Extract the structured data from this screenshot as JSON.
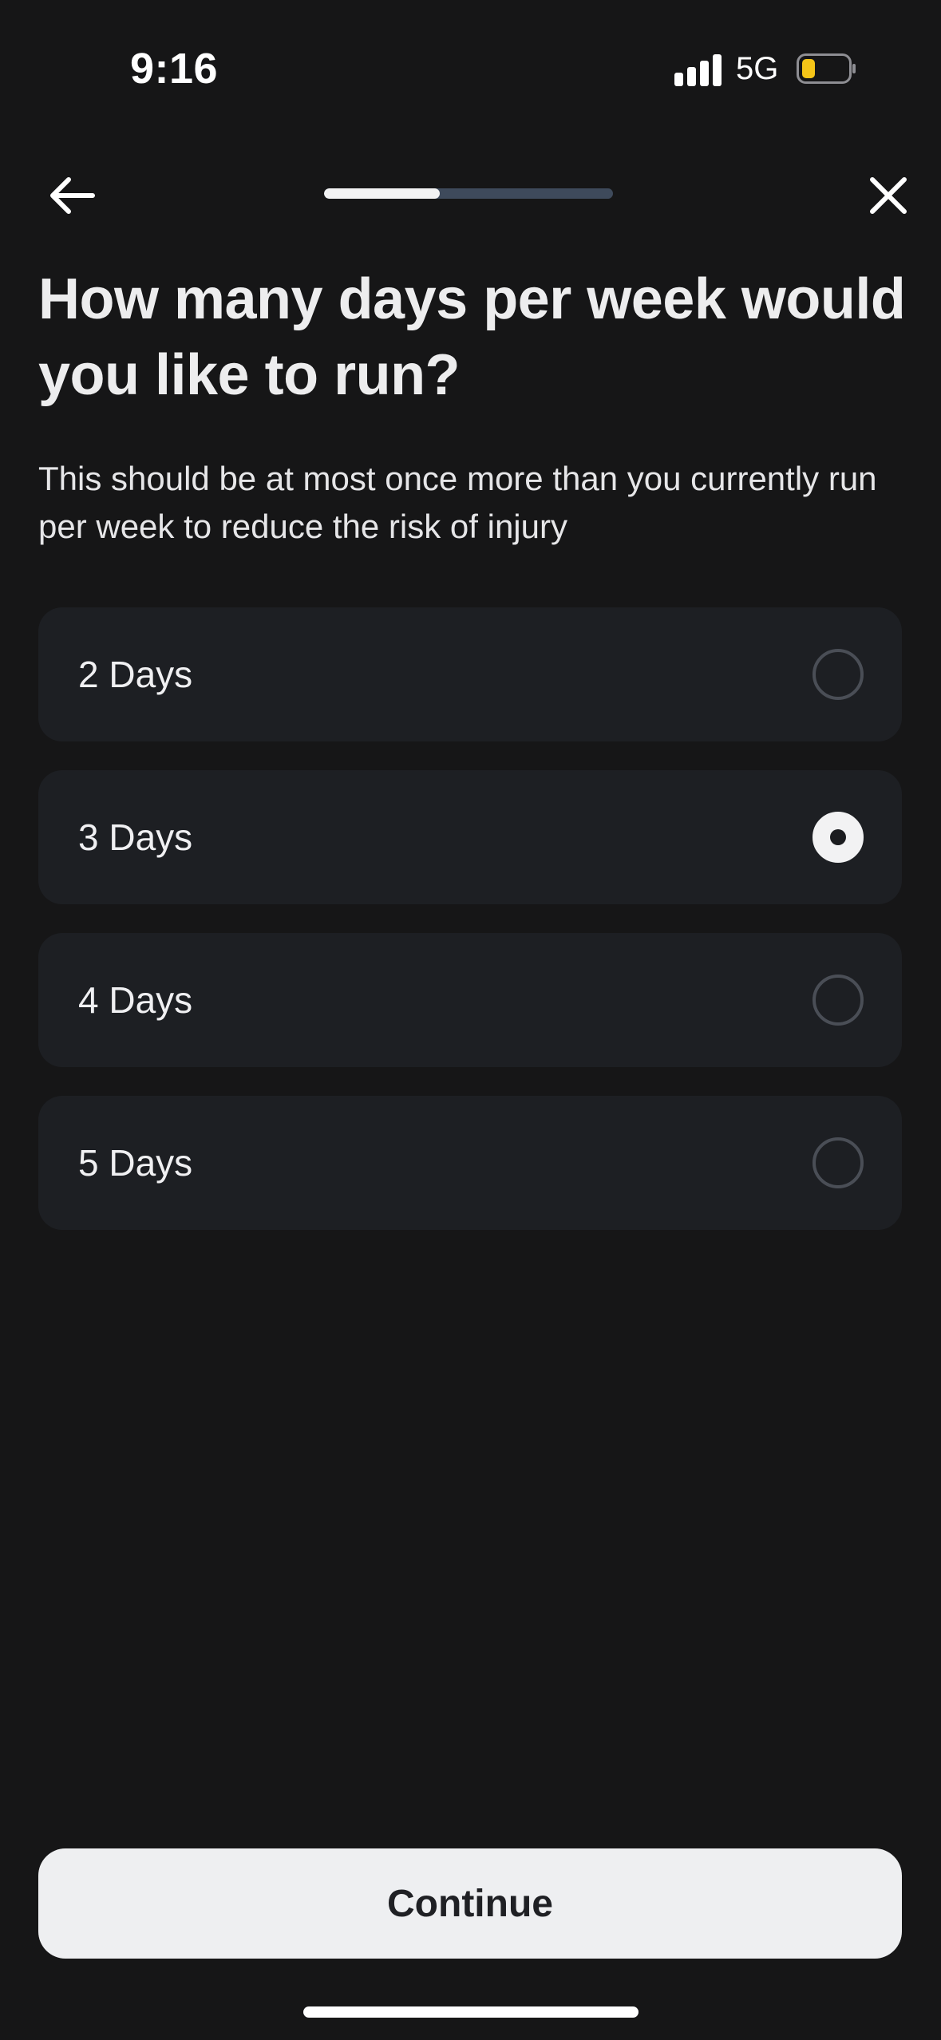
{
  "status_bar": {
    "time": "9:16",
    "network": "5G",
    "battery_color": "#F5C518",
    "signal_bars": 4
  },
  "nav": {
    "back_icon": "arrow-left-icon",
    "close_icon": "close-icon",
    "progress": 0.4
  },
  "header": {
    "title": "How many days per week would you like to run?",
    "subtitle": "This should be at most once more than you currently run per week to reduce the risk of injury"
  },
  "options": [
    {
      "label": "2 Days",
      "selected": false
    },
    {
      "label": "3 Days",
      "selected": true
    },
    {
      "label": "4 Days",
      "selected": false
    },
    {
      "label": "5 Days",
      "selected": false
    }
  ],
  "footer": {
    "continue_label": "Continue"
  },
  "colors": {
    "background": "#161617",
    "card": "#1D1F23",
    "progress_track": "#3E4A5B",
    "progress_fill": "#F2F2F3",
    "button": "#EEEFF1"
  }
}
